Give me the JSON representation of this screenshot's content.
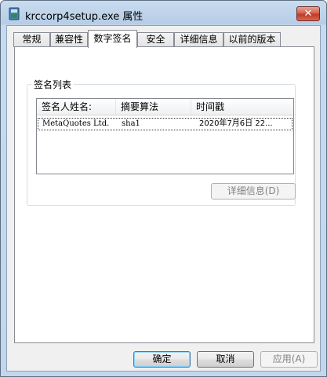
{
  "window": {
    "title": "krccorp4setup.exe 属性",
    "close_label": "✕"
  },
  "tabs": [
    {
      "label": "常规"
    },
    {
      "label": "兼容性"
    },
    {
      "label": "数字签名",
      "active": true
    },
    {
      "label": "安全"
    },
    {
      "label": "详细信息"
    },
    {
      "label": "以前的版本"
    }
  ],
  "signature_group": {
    "legend": "签名列表",
    "columns": [
      "签名人姓名:",
      "摘要算法",
      "时间戳"
    ],
    "rows": [
      {
        "signer": "MetaQuotes Ltd.",
        "digest": "sha1",
        "timestamp": "2020年7月6日 22..."
      }
    ],
    "details_button": "详细信息(D)"
  },
  "buttons": {
    "ok": "确定",
    "cancel": "取消",
    "apply": "应用(A)"
  },
  "colors": {
    "accent": "#3c7fb1",
    "close_button": "#c0392b"
  }
}
